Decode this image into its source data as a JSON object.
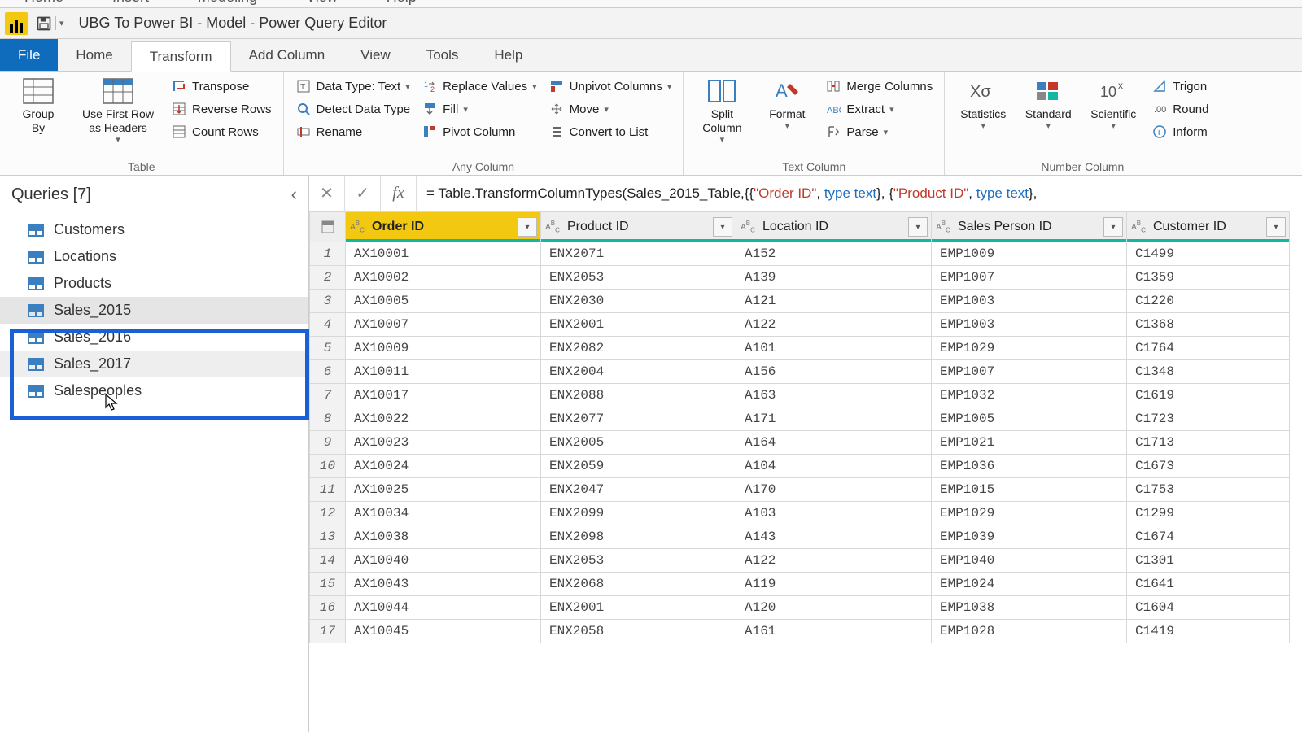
{
  "topmenu": [
    "Home",
    "Insert",
    "Modeling",
    "View",
    "Help"
  ],
  "title": "UBG To Power BI - Model - Power Query Editor",
  "ribbonTabs": {
    "file": "File",
    "items": [
      "Home",
      "Transform",
      "Add Column",
      "View",
      "Tools",
      "Help"
    ],
    "activeIndex": 1
  },
  "ribbon": {
    "table": {
      "groupBy": "Group\nBy",
      "useFirstRow": "Use First Row\nas Headers",
      "transpose": "Transpose",
      "reverseRows": "Reverse Rows",
      "countRows": "Count Rows",
      "label": "Table"
    },
    "anyColumn": {
      "dataType": "Data Type: Text",
      "detect": "Detect Data Type",
      "rename": "Rename",
      "replace": "Replace Values",
      "fill": "Fill",
      "pivot": "Pivot Column",
      "unpivot": "Unpivot Columns",
      "move": "Move",
      "convert": "Convert to List",
      "label": "Any Column"
    },
    "textColumn": {
      "split": "Split\nColumn",
      "format": "Format",
      "merge": "Merge Columns",
      "extract": "Extract",
      "parse": "Parse",
      "label": "Text Column"
    },
    "numberColumn": {
      "statistics": "Statistics",
      "standard": "Standard",
      "scientific": "Scientific",
      "trig": "Trigon",
      "round": "Round",
      "info": "Inform",
      "label": "Number Column"
    }
  },
  "queriesPane": {
    "title": "Queries [7]",
    "items": [
      "Customers",
      "Locations",
      "Products",
      "Sales_2015",
      "Sales_2016",
      "Sales_2017",
      "Salespeoples"
    ],
    "selectedIndex": 3,
    "hoverIndex": 5
  },
  "formula": {
    "prefix": "= Table.TransformColumnTypes(Sales_2015_Table,{{",
    "s1": "\"Order ID\"",
    "mid1": ", ",
    "t1": "type text",
    "mid2": "}, {",
    "s2": "\"Product ID\"",
    "mid3": ", ",
    "t2": "type text",
    "suffix": "},"
  },
  "columns": [
    "Order ID",
    "Product ID",
    "Location ID",
    "Sales Person ID",
    "Customer ID"
  ],
  "selectedColumn": 0,
  "rows": [
    [
      "AX10001",
      "ENX2071",
      "A152",
      "EMP1009",
      "C1499"
    ],
    [
      "AX10002",
      "ENX2053",
      "A139",
      "EMP1007",
      "C1359"
    ],
    [
      "AX10005",
      "ENX2030",
      "A121",
      "EMP1003",
      "C1220"
    ],
    [
      "AX10007",
      "ENX2001",
      "A122",
      "EMP1003",
      "C1368"
    ],
    [
      "AX10009",
      "ENX2082",
      "A101",
      "EMP1029",
      "C1764"
    ],
    [
      "AX10011",
      "ENX2004",
      "A156",
      "EMP1007",
      "C1348"
    ],
    [
      "AX10017",
      "ENX2088",
      "A163",
      "EMP1032",
      "C1619"
    ],
    [
      "AX10022",
      "ENX2077",
      "A171",
      "EMP1005",
      "C1723"
    ],
    [
      "AX10023",
      "ENX2005",
      "A164",
      "EMP1021",
      "C1713"
    ],
    [
      "AX10024",
      "ENX2059",
      "A104",
      "EMP1036",
      "C1673"
    ],
    [
      "AX10025",
      "ENX2047",
      "A170",
      "EMP1015",
      "C1753"
    ],
    [
      "AX10034",
      "ENX2099",
      "A103",
      "EMP1029",
      "C1299"
    ],
    [
      "AX10038",
      "ENX2098",
      "A143",
      "EMP1039",
      "C1674"
    ],
    [
      "AX10040",
      "ENX2053",
      "A122",
      "EMP1040",
      "C1301"
    ],
    [
      "AX10043",
      "ENX2068",
      "A119",
      "EMP1024",
      "C1641"
    ],
    [
      "AX10044",
      "ENX2001",
      "A120",
      "EMP1038",
      "C1604"
    ],
    [
      "AX10045",
      "ENX2058",
      "A161",
      "EMP1028",
      "C1419"
    ]
  ]
}
